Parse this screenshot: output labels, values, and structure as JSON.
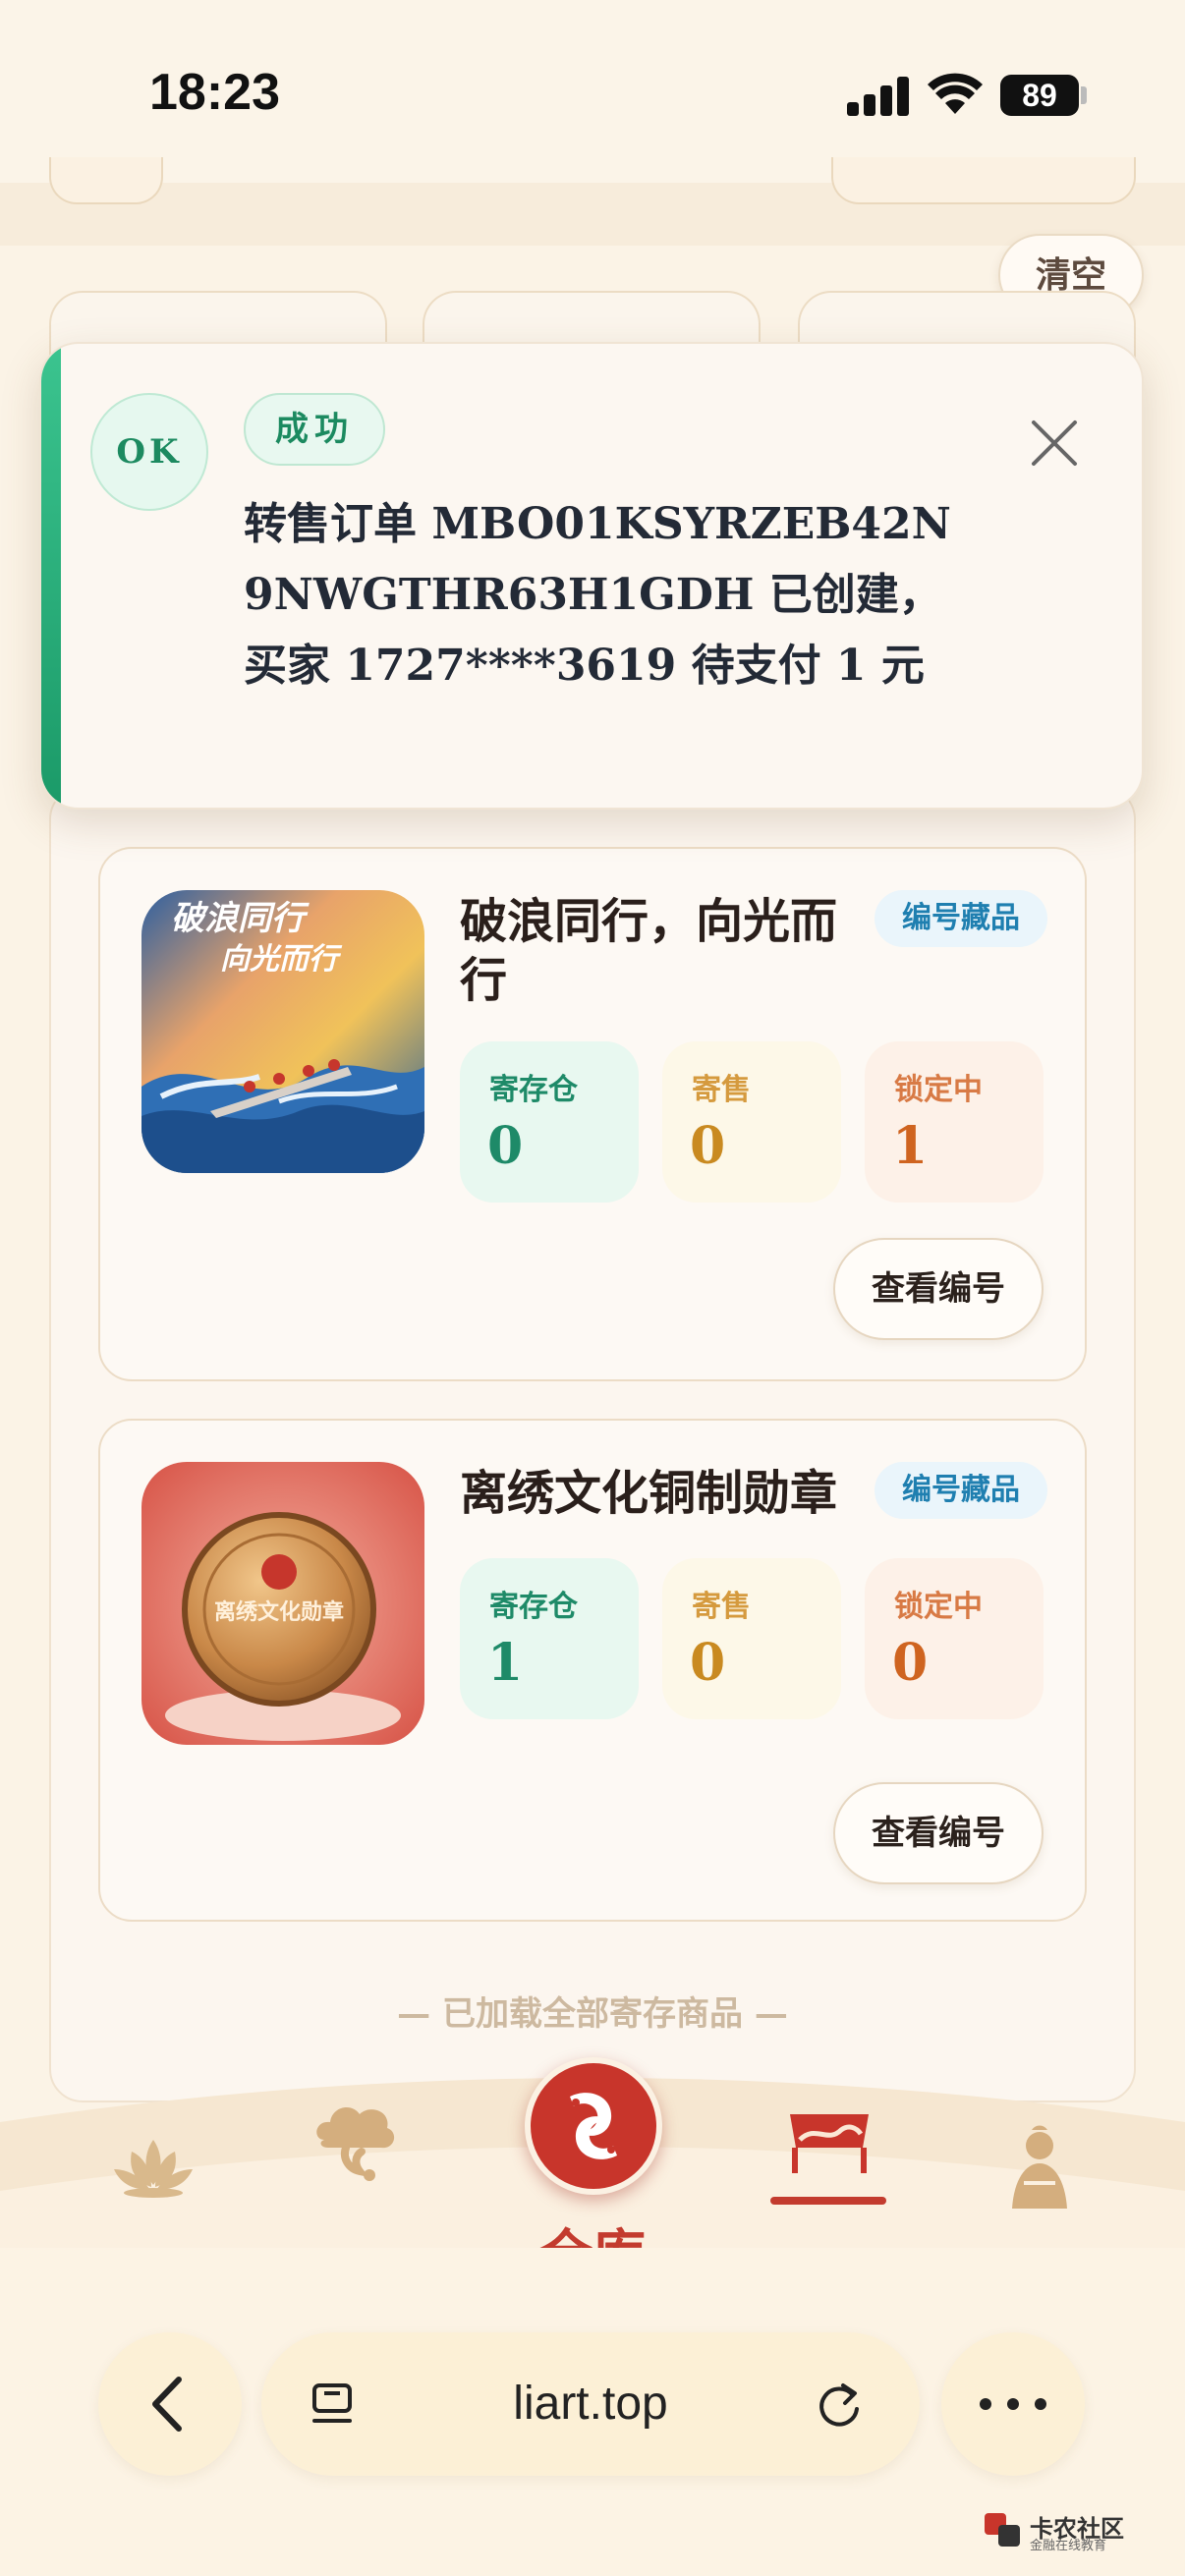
{
  "status_bar": {
    "time": "18:23",
    "battery": "89"
  },
  "header": {
    "clear_label": "清空"
  },
  "toast": {
    "icon_text": "OK",
    "tag": "成功",
    "message": "转售订单 MBO01KSYRZEB42N9NWGTHR63H1GDH 已创建，买家 1727****3619 待支付 1 元"
  },
  "items": [
    {
      "title": "破浪同行，向光而行",
      "badge": "编号藏品",
      "image_caption": "破浪同行 向光而行",
      "stats": [
        {
          "label": "寄存仓",
          "value": "0"
        },
        {
          "label": "寄售",
          "value": "0"
        },
        {
          "label": "锁定中",
          "value": "1"
        }
      ],
      "button": "查看编号"
    },
    {
      "title": "离绣文化铜制勋章",
      "badge": "编号藏品",
      "image_caption": "离绣文化勋章",
      "stats": [
        {
          "label": "寄存仓",
          "value": "1"
        },
        {
          "label": "寄售",
          "value": "0"
        },
        {
          "label": "锁定中",
          "value": "0"
        }
      ],
      "button": "查看编号"
    }
  ],
  "loaded_text": "— 已加载全部寄存商品 —",
  "nav": {
    "active_label": "仓库"
  },
  "browser": {
    "url": "liart.top"
  },
  "watermark": {
    "title": "卡农社区",
    "subtitle": "金融在线教育"
  },
  "colors": {
    "accent_red": "#c33b2e",
    "success_green": "#1c8a60",
    "badge_blue": "#1f7fb0"
  }
}
